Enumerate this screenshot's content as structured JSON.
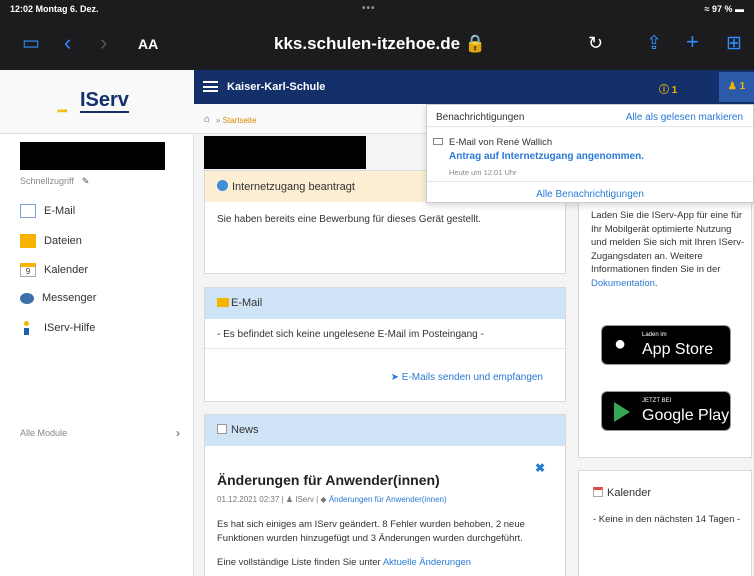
{
  "status_bar": {
    "time_date": "12:02  Montag 6. Dez.",
    "battery": "≈ 97 % ▬"
  },
  "browser": {
    "text_size": "AA",
    "url": "kks.schulen-itzehoe.de 🔒"
  },
  "app": {
    "logo_text": "IServ",
    "school_name": "Kaiser-Karl-Schule",
    "info_count": "1",
    "notif_count": "1"
  },
  "sidebar": {
    "quick_access": "Schnellzugriff",
    "items": [
      {
        "label": "E-Mail"
      },
      {
        "label": "Dateien"
      },
      {
        "label": "Kalender"
      },
      {
        "label": "Messenger"
      },
      {
        "label": "IServ-Hilfe"
      }
    ],
    "calendar_icon_day": "9",
    "all_modules": "Alle Module"
  },
  "breadcrumb": {
    "home": "Startseite"
  },
  "internet_panel": {
    "title": "Internetzugang beantragt",
    "body": "Sie haben bereits eine Bewerbung für dieses Gerät gestellt."
  },
  "email_panel": {
    "title": "E-Mail",
    "body": "- Es befindet sich keine ungelesene E-Mail im Posteingang -",
    "link": "E-Mails senden und empfangen"
  },
  "news_panel": {
    "title": "News",
    "article_title": "Änderungen für Anwender(innen)",
    "meta_date": "01.12.2021 02:37 | ",
    "meta_author": "IServ",
    "meta_category": "Änderungen für Anwender(innen)",
    "text1": "Es hat sich einiges am IServ geändert. 8 Fehler wurden behoben, 2 neue Funktionen wurden hinzugefügt und 3 Änderungen wurden durchgeführt.",
    "text2_prefix": "Eine vollständige Liste finden Sie unter ",
    "text2_link": "Aktuelle Änderungen"
  },
  "app_panel": {
    "text": "Laden Sie die IServ-App für eine für Ihr Mobilgerät optimierte Nutzung und melden Sie sich mit Ihren IServ-Zugangsdaten an. Weitere Informationen finden Sie in der ",
    "doc_link": "Dokumentation",
    "appstore_small": "Laden im",
    "appstore_big": "App Store",
    "googleplay_small": "JETZT BEI",
    "googleplay_big": "Google Play"
  },
  "calendar_panel": {
    "title": "Kalender",
    "body": "- Keine in den nächsten 14 Tagen -"
  },
  "notifications": {
    "title": "Benachrichtigungen",
    "mark_all": "Alle als gelesen markieren",
    "item_from": "E-Mail von René Wallich",
    "item_message": "Antrag auf Internetzugang angenommen.",
    "item_time": "Heute um 12:01 Uhr",
    "all_link": "Alle Benachrichtigungen"
  },
  "colors": {
    "header_blue": "#13306b",
    "link_blue": "#2a7ad5",
    "accent_yellow": "#f6b400"
  }
}
